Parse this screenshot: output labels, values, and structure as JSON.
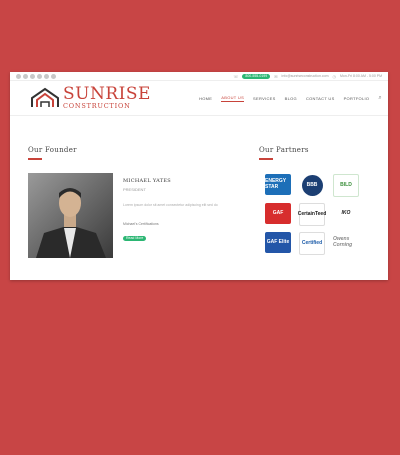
{
  "topbar": {
    "phone": "800-555-0199",
    "email": "info@sunriseconstruction.com",
    "hours": "Mon-Fri 8:00 AM - 5:00 PM"
  },
  "brand": {
    "name": "SUNRISE",
    "tagline": "CONSTRUCTION",
    "color": "#c8433a"
  },
  "nav": {
    "items": [
      "HOME",
      "ABOUT US",
      "SERVICES",
      "BLOG",
      "CONTACT US",
      "PORTFOLIO"
    ],
    "active_index": 1
  },
  "founder": {
    "section_title": "Our Founder",
    "name": "MICHAEL YATES",
    "role": "PRESIDENT",
    "description": "Lorem ipsum dolor sit amet consectetur adipiscing elit sed do",
    "more_label": "Michael's Certifications",
    "more_pill": "Read More"
  },
  "partners": {
    "section_title": "Our Partners",
    "logos": [
      "ENERGY STAR",
      "BBB",
      "BILD",
      "GAF",
      "CertainTeed",
      "IKO",
      "GAF Elite",
      "Certified",
      "Owens Corning"
    ]
  },
  "colors": {
    "background": "#c84545",
    "accent": "#c8433a",
    "green": "#2bb673"
  }
}
